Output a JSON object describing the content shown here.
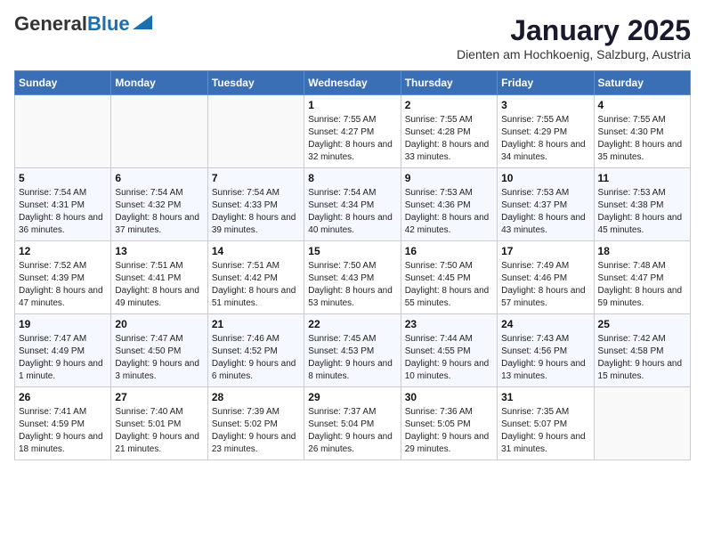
{
  "logo": {
    "general": "General",
    "blue": "Blue"
  },
  "header": {
    "month": "January 2025",
    "location": "Dienten am Hochkoenig, Salzburg, Austria"
  },
  "weekdays": [
    "Sunday",
    "Monday",
    "Tuesday",
    "Wednesday",
    "Thursday",
    "Friday",
    "Saturday"
  ],
  "weeks": [
    [
      {
        "day": "",
        "info": ""
      },
      {
        "day": "",
        "info": ""
      },
      {
        "day": "",
        "info": ""
      },
      {
        "day": "1",
        "info": "Sunrise: 7:55 AM\nSunset: 4:27 PM\nDaylight: 8 hours and 32 minutes."
      },
      {
        "day": "2",
        "info": "Sunrise: 7:55 AM\nSunset: 4:28 PM\nDaylight: 8 hours and 33 minutes."
      },
      {
        "day": "3",
        "info": "Sunrise: 7:55 AM\nSunset: 4:29 PM\nDaylight: 8 hours and 34 minutes."
      },
      {
        "day": "4",
        "info": "Sunrise: 7:55 AM\nSunset: 4:30 PM\nDaylight: 8 hours and 35 minutes."
      }
    ],
    [
      {
        "day": "5",
        "info": "Sunrise: 7:54 AM\nSunset: 4:31 PM\nDaylight: 8 hours and 36 minutes."
      },
      {
        "day": "6",
        "info": "Sunrise: 7:54 AM\nSunset: 4:32 PM\nDaylight: 8 hours and 37 minutes."
      },
      {
        "day": "7",
        "info": "Sunrise: 7:54 AM\nSunset: 4:33 PM\nDaylight: 8 hours and 39 minutes."
      },
      {
        "day": "8",
        "info": "Sunrise: 7:54 AM\nSunset: 4:34 PM\nDaylight: 8 hours and 40 minutes."
      },
      {
        "day": "9",
        "info": "Sunrise: 7:53 AM\nSunset: 4:36 PM\nDaylight: 8 hours and 42 minutes."
      },
      {
        "day": "10",
        "info": "Sunrise: 7:53 AM\nSunset: 4:37 PM\nDaylight: 8 hours and 43 minutes."
      },
      {
        "day": "11",
        "info": "Sunrise: 7:53 AM\nSunset: 4:38 PM\nDaylight: 8 hours and 45 minutes."
      }
    ],
    [
      {
        "day": "12",
        "info": "Sunrise: 7:52 AM\nSunset: 4:39 PM\nDaylight: 8 hours and 47 minutes."
      },
      {
        "day": "13",
        "info": "Sunrise: 7:51 AM\nSunset: 4:41 PM\nDaylight: 8 hours and 49 minutes."
      },
      {
        "day": "14",
        "info": "Sunrise: 7:51 AM\nSunset: 4:42 PM\nDaylight: 8 hours and 51 minutes."
      },
      {
        "day": "15",
        "info": "Sunrise: 7:50 AM\nSunset: 4:43 PM\nDaylight: 8 hours and 53 minutes."
      },
      {
        "day": "16",
        "info": "Sunrise: 7:50 AM\nSunset: 4:45 PM\nDaylight: 8 hours and 55 minutes."
      },
      {
        "day": "17",
        "info": "Sunrise: 7:49 AM\nSunset: 4:46 PM\nDaylight: 8 hours and 57 minutes."
      },
      {
        "day": "18",
        "info": "Sunrise: 7:48 AM\nSunset: 4:47 PM\nDaylight: 8 hours and 59 minutes."
      }
    ],
    [
      {
        "day": "19",
        "info": "Sunrise: 7:47 AM\nSunset: 4:49 PM\nDaylight: 9 hours and 1 minute."
      },
      {
        "day": "20",
        "info": "Sunrise: 7:47 AM\nSunset: 4:50 PM\nDaylight: 9 hours and 3 minutes."
      },
      {
        "day": "21",
        "info": "Sunrise: 7:46 AM\nSunset: 4:52 PM\nDaylight: 9 hours and 6 minutes."
      },
      {
        "day": "22",
        "info": "Sunrise: 7:45 AM\nSunset: 4:53 PM\nDaylight: 9 hours and 8 minutes."
      },
      {
        "day": "23",
        "info": "Sunrise: 7:44 AM\nSunset: 4:55 PM\nDaylight: 9 hours and 10 minutes."
      },
      {
        "day": "24",
        "info": "Sunrise: 7:43 AM\nSunset: 4:56 PM\nDaylight: 9 hours and 13 minutes."
      },
      {
        "day": "25",
        "info": "Sunrise: 7:42 AM\nSunset: 4:58 PM\nDaylight: 9 hours and 15 minutes."
      }
    ],
    [
      {
        "day": "26",
        "info": "Sunrise: 7:41 AM\nSunset: 4:59 PM\nDaylight: 9 hours and 18 minutes."
      },
      {
        "day": "27",
        "info": "Sunrise: 7:40 AM\nSunset: 5:01 PM\nDaylight: 9 hours and 21 minutes."
      },
      {
        "day": "28",
        "info": "Sunrise: 7:39 AM\nSunset: 5:02 PM\nDaylight: 9 hours and 23 minutes."
      },
      {
        "day": "29",
        "info": "Sunrise: 7:37 AM\nSunset: 5:04 PM\nDaylight: 9 hours and 26 minutes."
      },
      {
        "day": "30",
        "info": "Sunrise: 7:36 AM\nSunset: 5:05 PM\nDaylight: 9 hours and 29 minutes."
      },
      {
        "day": "31",
        "info": "Sunrise: 7:35 AM\nSunset: 5:07 PM\nDaylight: 9 hours and 31 minutes."
      },
      {
        "day": "",
        "info": ""
      }
    ]
  ]
}
